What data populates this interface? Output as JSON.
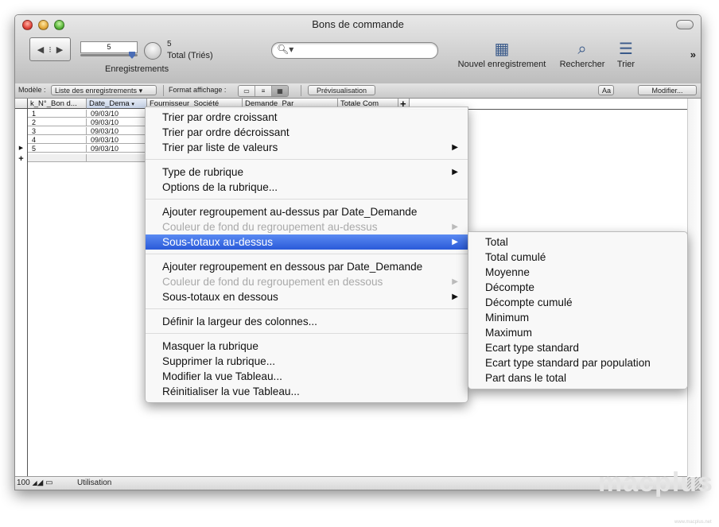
{
  "window": {
    "title": "Bons de commande"
  },
  "toolbar": {
    "record_current": "5",
    "record_count": "5",
    "record_status": "Total (Triés)",
    "records_label": "Enregistrements",
    "search_placeholder": "",
    "new_record_label": "Nouvel enregistrement",
    "find_label": "Rechercher",
    "sort_label": "Trier",
    "overflow_glyph": "»"
  },
  "layout_bar": {
    "model_label": "Modèle :",
    "model_value": "Liste des enregistrements",
    "display_format_label": "Format affichage :",
    "preview_button": "Prévisualisation",
    "font_button": "Aa",
    "edit_button": "Modifier..."
  },
  "table": {
    "headers": [
      "k_N°_Bon d...",
      "Date_Dema",
      "Fournisseur_Société",
      "Demande_Par",
      "Totale Com"
    ],
    "add_column": "+",
    "rows": [
      [
        "1",
        "09/03/10"
      ],
      [
        "2",
        "09/03/10"
      ],
      [
        "3",
        "09/03/10"
      ],
      [
        "4",
        "09/03/10"
      ],
      [
        "5",
        "09/03/10"
      ]
    ],
    "current_row_marker": "▶",
    "new_row_marker": "+"
  },
  "status": {
    "zoom": "100",
    "mode": "Utilisation"
  },
  "context_menu": {
    "groups": [
      [
        {
          "label": "Trier par ordre croissant"
        },
        {
          "label": "Trier par ordre décroissant"
        },
        {
          "label": "Trier par liste de valeurs",
          "submenu": true
        }
      ],
      [
        {
          "label": "Type de rubrique",
          "submenu": true
        },
        {
          "label": "Options de la rubrique..."
        }
      ],
      [
        {
          "label": "Ajouter regroupement au-dessus par Date_Demande"
        },
        {
          "label": "Couleur de fond du regroupement au-dessus",
          "submenu": true,
          "disabled": true
        },
        {
          "label": "Sous-totaux au-dessus",
          "submenu": true,
          "highlighted": true
        }
      ],
      [
        {
          "label": "Ajouter regroupement en dessous par Date_Demande"
        },
        {
          "label": "Couleur de fond du regroupement en dessous",
          "submenu": true,
          "disabled": true
        },
        {
          "label": "Sous-totaux en dessous",
          "submenu": true
        }
      ],
      [
        {
          "label": "Définir la largeur des colonnes..."
        }
      ],
      [
        {
          "label": "Masquer la rubrique"
        },
        {
          "label": "Supprimer la rubrique..."
        },
        {
          "label": "Modifier la vue Tableau..."
        },
        {
          "label": "Réinitialiser la vue Tableau..."
        }
      ]
    ]
  },
  "submenu": {
    "items": [
      "Total",
      "Total cumulé",
      "Moyenne",
      "Décompte",
      "Décompte cumulé",
      "Minimum",
      "Maximum",
      "Ecart type standard",
      "Ecart type standard par population",
      "Part dans le total"
    ]
  },
  "watermark": {
    "text": "macplus",
    "url": "www.macplus.net"
  },
  "colors": {
    "highlight": "#2a5ad9",
    "disabled": "#a9a9a9",
    "toolbar_icon": "#3a5a8a"
  },
  "icons": {
    "new_record": "new-record-icon",
    "find": "magnifier-icon",
    "sort": "sort-icon",
    "search": "search-icon"
  }
}
